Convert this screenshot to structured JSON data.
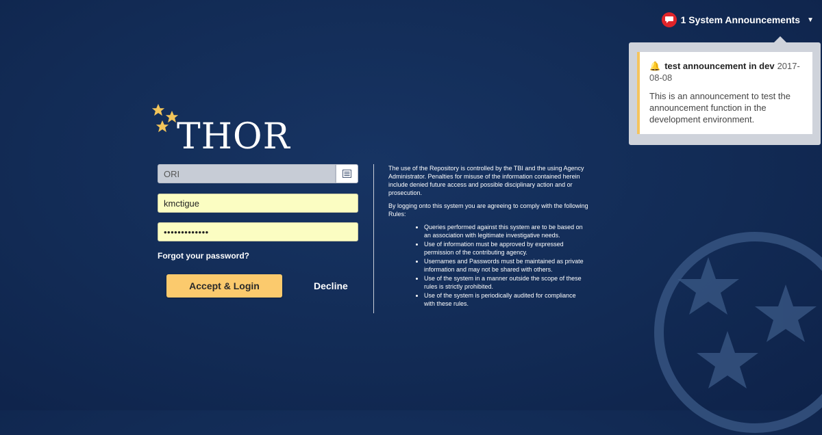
{
  "announcements": {
    "label": "1 System Announcements",
    "icon": "speech-bubble-icon",
    "items": [
      {
        "title": "test announcement in dev",
        "date": "2017-08-08",
        "body": "This is an announcement to test the announcement function in the development environment."
      }
    ]
  },
  "logo": {
    "text": "THOR"
  },
  "login": {
    "ori_value": "ORI",
    "username_value": "kmctigue",
    "password_value": "•••••••••••••",
    "forgot_label": "Forgot your password?",
    "accept_label": "Accept & Login",
    "decline_label": "Decline"
  },
  "rules": {
    "intro": "The use of the Repository is controlled by the TBI and the using Agency Administrator. Penalties for misuse of the information contained herein include denied future access and possible disciplinary action and or prosecution.",
    "agree": "By logging onto this system you are agreeing to comply with the following Rules:",
    "items": [
      "Queries performed against this system are to be based on an association with legitimate investigative needs.",
      "Use of information must be approved by expressed permission of the contributing agency.",
      "Usernames and Passwords must be maintained as private information and may not be shared with others.",
      "Use of the system in a manner outside the scope of these rules is strictly prohibited.",
      "Use of the system is periodically audited for compliance with these rules."
    ]
  },
  "colors": {
    "background": "#122b55",
    "accent": "#fbca6d",
    "field_fill": "#fbfdc2",
    "badge": "#e0242a",
    "star": "#f2c45a"
  }
}
